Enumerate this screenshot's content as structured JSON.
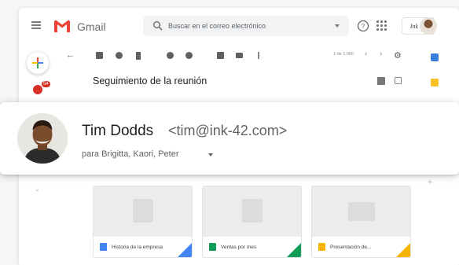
{
  "app": {
    "brand": "Gmail"
  },
  "search": {
    "placeholder": "Buscar en el correo electrónico"
  },
  "header": {
    "org_logo_text": "Ink 42"
  },
  "left_rail": {
    "badge_count": "54"
  },
  "toolbar": {
    "pager": "1 de 1.000"
  },
  "message": {
    "subject": "Seguimiento de la reunión",
    "sender_name": "Tim Dodds",
    "sender_email": "<tim@ink-42.com>",
    "recipients": "para Brigitta, Kaori, Peter"
  },
  "attachments": [
    {
      "name": "Historia de la empresa",
      "type": "docs",
      "color": "#4285f4"
    },
    {
      "name": "Ventas por mes",
      "type": "sheets",
      "color": "#0f9d58"
    },
    {
      "name": "Presentación de...",
      "type": "slides",
      "color": "#f4b400"
    }
  ],
  "colors": {
    "gmail_red": "#ea4335",
    "badge_red": "#d93025",
    "calendar_blue": "#3b7ddd",
    "keep_yellow": "#f6c026"
  }
}
